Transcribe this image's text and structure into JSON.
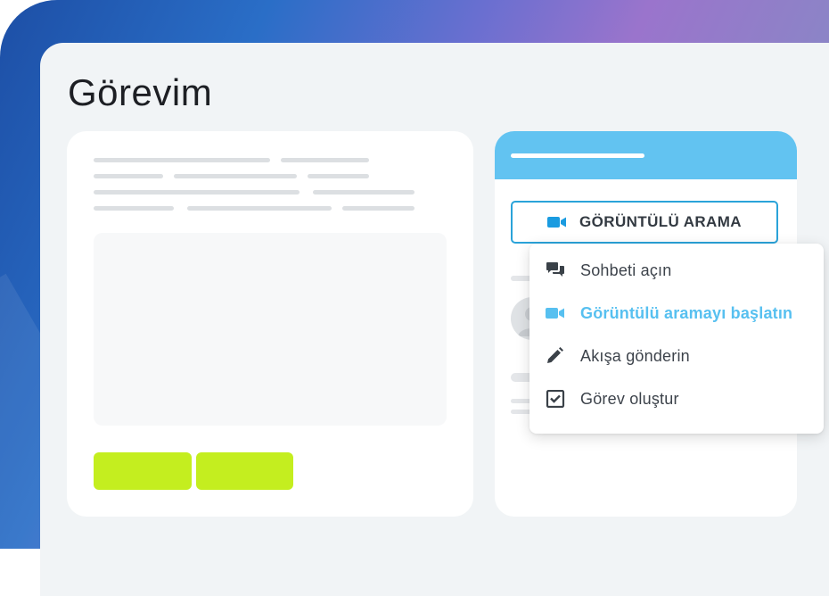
{
  "page": {
    "title": "Görevim"
  },
  "video_call": {
    "label": "GÖRÜNTÜLÜ ARAMA",
    "icon": "video-camera-icon",
    "accent": "#2aa3d9"
  },
  "menu": {
    "items": [
      {
        "label": "Sohbeti açın",
        "icon": "chat-bubbles-icon",
        "active": false
      },
      {
        "label": "Görüntülü aramayı başlatın",
        "icon": "video-camera-icon",
        "active": true
      },
      {
        "label": "Akışa gönderin",
        "icon": "pencil-icon",
        "active": false
      },
      {
        "label": "Görev oluştur",
        "icon": "task-checkbox-icon",
        "active": false
      }
    ]
  },
  "colors": {
    "header_blue": "#62c3f1",
    "active_text": "#57c0f0",
    "green_button": "#c4ee1f",
    "panel_bg": "#f1f4f6"
  }
}
